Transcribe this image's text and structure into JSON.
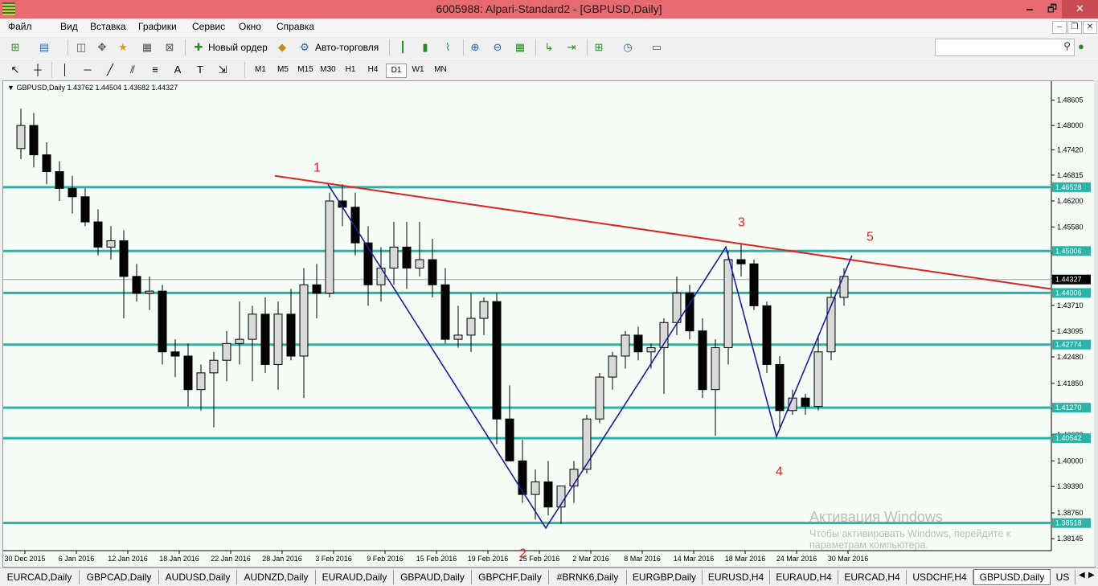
{
  "window": {
    "title": "6005988: Alpari-Standard2 - [GBPUSD,Daily]",
    "min": "🗕",
    "restore": "🗗",
    "close": "✕"
  },
  "menu": [
    "Файл",
    "Вид",
    "Вставка",
    "Графики",
    "Сервис",
    "Окно",
    "Справка"
  ],
  "mdi": {
    "min": "–",
    "restore": "❐",
    "close": "✕"
  },
  "toolbar": {
    "new_order": "Новый ордер",
    "auto_trading": "Авто-торговля"
  },
  "timeframes": [
    "M1",
    "M5",
    "M15",
    "M30",
    "H1",
    "H4",
    "D1",
    "W1",
    "MN"
  ],
  "active_timeframe": "D1",
  "chart": {
    "header": "GBPUSD,Daily  1.43762 1.44504 1.43682 1.44327",
    "current_price": "1.44327",
    "current_price_value": 1.44327,
    "y_range": [
      1.3786,
      1.4898
    ],
    "price_ticks": [
      "1.48605",
      "1.48000",
      "1.47420",
      "1.46815",
      "1.46200",
      "1.45580",
      "1.44950",
      "1.44350",
      "1.43710",
      "1.43095",
      "1.42480",
      "1.41850",
      "1.41250",
      "1.40620",
      "1.40000",
      "1.39390",
      "1.38760",
      "1.38145"
    ],
    "levels": [
      {
        "label": "1.46528",
        "value": 1.46528
      },
      {
        "label": "1.45006",
        "value": 1.45006
      },
      {
        "label": "1.44006",
        "value": 1.44006
      },
      {
        "label": "1.42774",
        "value": 1.42774
      },
      {
        "label": "1.41270",
        "value": 1.4127
      },
      {
        "label": "1.40542",
        "value": 1.40542
      },
      {
        "label": "1.38518",
        "value": 1.38518
      }
    ],
    "dates": [
      "30 Dec 2015",
      "6 Jan 2016",
      "12 Jan 2016",
      "18 Jan 2016",
      "22 Jan 2016",
      "28 Jan 2016",
      "3 Feb 2016",
      "9 Feb 2016",
      "15 Feb 2016",
      "19 Feb 2016",
      "25 Feb 2016",
      "2 Mar 2016",
      "8 Mar 2016",
      "14 Mar 2016",
      "18 Mar 2016",
      "24 Mar 2016",
      "30 Mar 2016"
    ],
    "wave_labels": [
      "1",
      "2",
      "3",
      "4",
      "5"
    ],
    "level_color": "#2ab3a6",
    "trend_color": "#e32020",
    "wave_color": "#1c1c9c"
  },
  "watermark": {
    "line1": "Активация Windows",
    "line2": "Чтобы активировать Windows, перейдите к",
    "line3": "параметрам компьютера."
  },
  "tabs": [
    "EURCAD,Daily",
    "GBPCAD,Daily",
    "AUDUSD,Daily",
    "AUDNZD,Daily",
    "EURAUD,Daily",
    "GBPAUD,Daily",
    "GBPCHF,Daily",
    "#BRNK6,Daily",
    "EURGBP,Daily",
    "EURUSD,H4",
    "EURAUD,H4",
    "EURCAD,H4",
    "USDCHF,H4",
    "GBPUSD,Daily",
    "US"
  ],
  "active_tab": "GBPUSD,Daily",
  "candles": [
    [
      1.4745,
      1.484,
      1.472,
      1.48
    ],
    [
      1.48,
      1.483,
      1.47,
      1.473
    ],
    [
      1.473,
      1.476,
      1.466,
      1.469
    ],
    [
      1.469,
      1.4715,
      1.462,
      1.465
    ],
    [
      1.465,
      1.468,
      1.459,
      1.463
    ],
    [
      1.463,
      1.465,
      1.456,
      1.457
    ],
    [
      1.457,
      1.46,
      1.449,
      1.451
    ],
    [
      1.451,
      1.456,
      1.448,
      1.4525
    ],
    [
      1.4525,
      1.455,
      1.434,
      1.444
    ],
    [
      1.444,
      1.447,
      1.438,
      1.44
    ],
    [
      1.44,
      1.444,
      1.436,
      1.4405
    ],
    [
      1.4405,
      1.442,
      1.423,
      1.426
    ],
    [
      1.426,
      1.429,
      1.42,
      1.425
    ],
    [
      1.425,
      1.428,
      1.413,
      1.417
    ],
    [
      1.417,
      1.423,
      1.412,
      1.421
    ],
    [
      1.421,
      1.426,
      1.408,
      1.424
    ],
    [
      1.424,
      1.431,
      1.419,
      1.428
    ],
    [
      1.428,
      1.438,
      1.423,
      1.429
    ],
    [
      1.429,
      1.437,
      1.419,
      1.435
    ],
    [
      1.435,
      1.439,
      1.421,
      1.423
    ],
    [
      1.423,
      1.438,
      1.417,
      1.435
    ],
    [
      1.435,
      1.441,
      1.424,
      1.425
    ],
    [
      1.425,
      1.446,
      1.415,
      1.442
    ],
    [
      1.442,
      1.447,
      1.434,
      1.44
    ],
    [
      1.44,
      1.464,
      1.439,
      1.462
    ],
    [
      1.462,
      1.466,
      1.456,
      1.4605
    ],
    [
      1.4605,
      1.464,
      1.449,
      1.452
    ],
    [
      1.452,
      1.456,
      1.437,
      1.442
    ],
    [
      1.442,
      1.451,
      1.438,
      1.446
    ],
    [
      1.446,
      1.457,
      1.442,
      1.451
    ],
    [
      1.451,
      1.457,
      1.441,
      1.446
    ],
    [
      1.446,
      1.457,
      1.444,
      1.448
    ],
    [
      1.448,
      1.453,
      1.439,
      1.442
    ],
    [
      1.442,
      1.446,
      1.428,
      1.429
    ],
    [
      1.429,
      1.437,
      1.427,
      1.43
    ],
    [
      1.43,
      1.44,
      1.426,
      1.434
    ],
    [
      1.434,
      1.439,
      1.43,
      1.438
    ],
    [
      1.438,
      1.44,
      1.404,
      1.41
    ],
    [
      1.41,
      1.418,
      1.404,
      1.4
    ],
    [
      1.4,
      1.405,
      1.39,
      1.392
    ],
    [
      1.392,
      1.398,
      1.386,
      1.395
    ],
    [
      1.395,
      1.4,
      1.387,
      1.389
    ],
    [
      1.389,
      1.393,
      1.385,
      1.394
    ],
    [
      1.394,
      1.4,
      1.39,
      1.398
    ],
    [
      1.398,
      1.411,
      1.397,
      1.41
    ],
    [
      1.41,
      1.421,
      1.409,
      1.42
    ],
    [
      1.42,
      1.426,
      1.417,
      1.425
    ],
    [
      1.425,
      1.431,
      1.422,
      1.43
    ],
    [
      1.43,
      1.432,
      1.424,
      1.426
    ],
    [
      1.426,
      1.428,
      1.422,
      1.427
    ],
    [
      1.427,
      1.434,
      1.416,
      1.433
    ],
    [
      1.433,
      1.444,
      1.43,
      1.44
    ],
    [
      1.44,
      1.442,
      1.429,
      1.431
    ],
    [
      1.431,
      1.434,
      1.415,
      1.417
    ],
    [
      1.417,
      1.429,
      1.406,
      1.427
    ],
    [
      1.427,
      1.45,
      1.423,
      1.448
    ],
    [
      1.448,
      1.452,
      1.444,
      1.447
    ],
    [
      1.447,
      1.448,
      1.436,
      1.437
    ],
    [
      1.437,
      1.438,
      1.421,
      1.423
    ],
    [
      1.423,
      1.425,
      1.408,
      1.412
    ],
    [
      1.412,
      1.417,
      1.411,
      1.415
    ],
    [
      1.415,
      1.416,
      1.411,
      1.413
    ],
    [
      1.413,
      1.43,
      1.412,
      1.426
    ],
    [
      1.426,
      1.441,
      1.424,
      1.439
    ],
    [
      1.439,
      1.446,
      1.437,
      1.444
    ]
  ]
}
